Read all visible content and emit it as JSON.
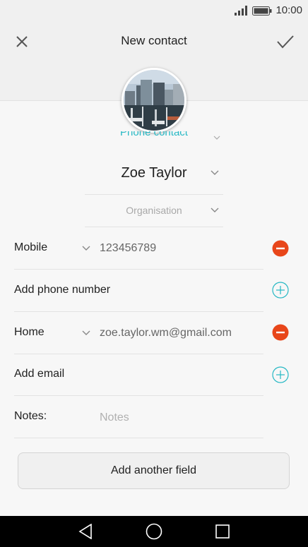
{
  "status_bar": {
    "time": "10:00"
  },
  "header": {
    "title": "New contact"
  },
  "account": {
    "label": "Phone contact"
  },
  "name": {
    "value": "Zoe Taylor"
  },
  "organisation": {
    "placeholder": "Organisation"
  },
  "phone": {
    "type": "Mobile",
    "value": "123456789",
    "add_label": "Add phone number"
  },
  "email": {
    "type": "Home",
    "value": "zoe.taylor.wm@gmail.com",
    "add_label": "Add email"
  },
  "notes": {
    "label": "Notes:",
    "placeholder": "Notes"
  },
  "add_field_button": "Add another field",
  "colors": {
    "accent": "#26b8c4",
    "remove": "#e8461a",
    "header_bg": "#f0f0f0"
  }
}
